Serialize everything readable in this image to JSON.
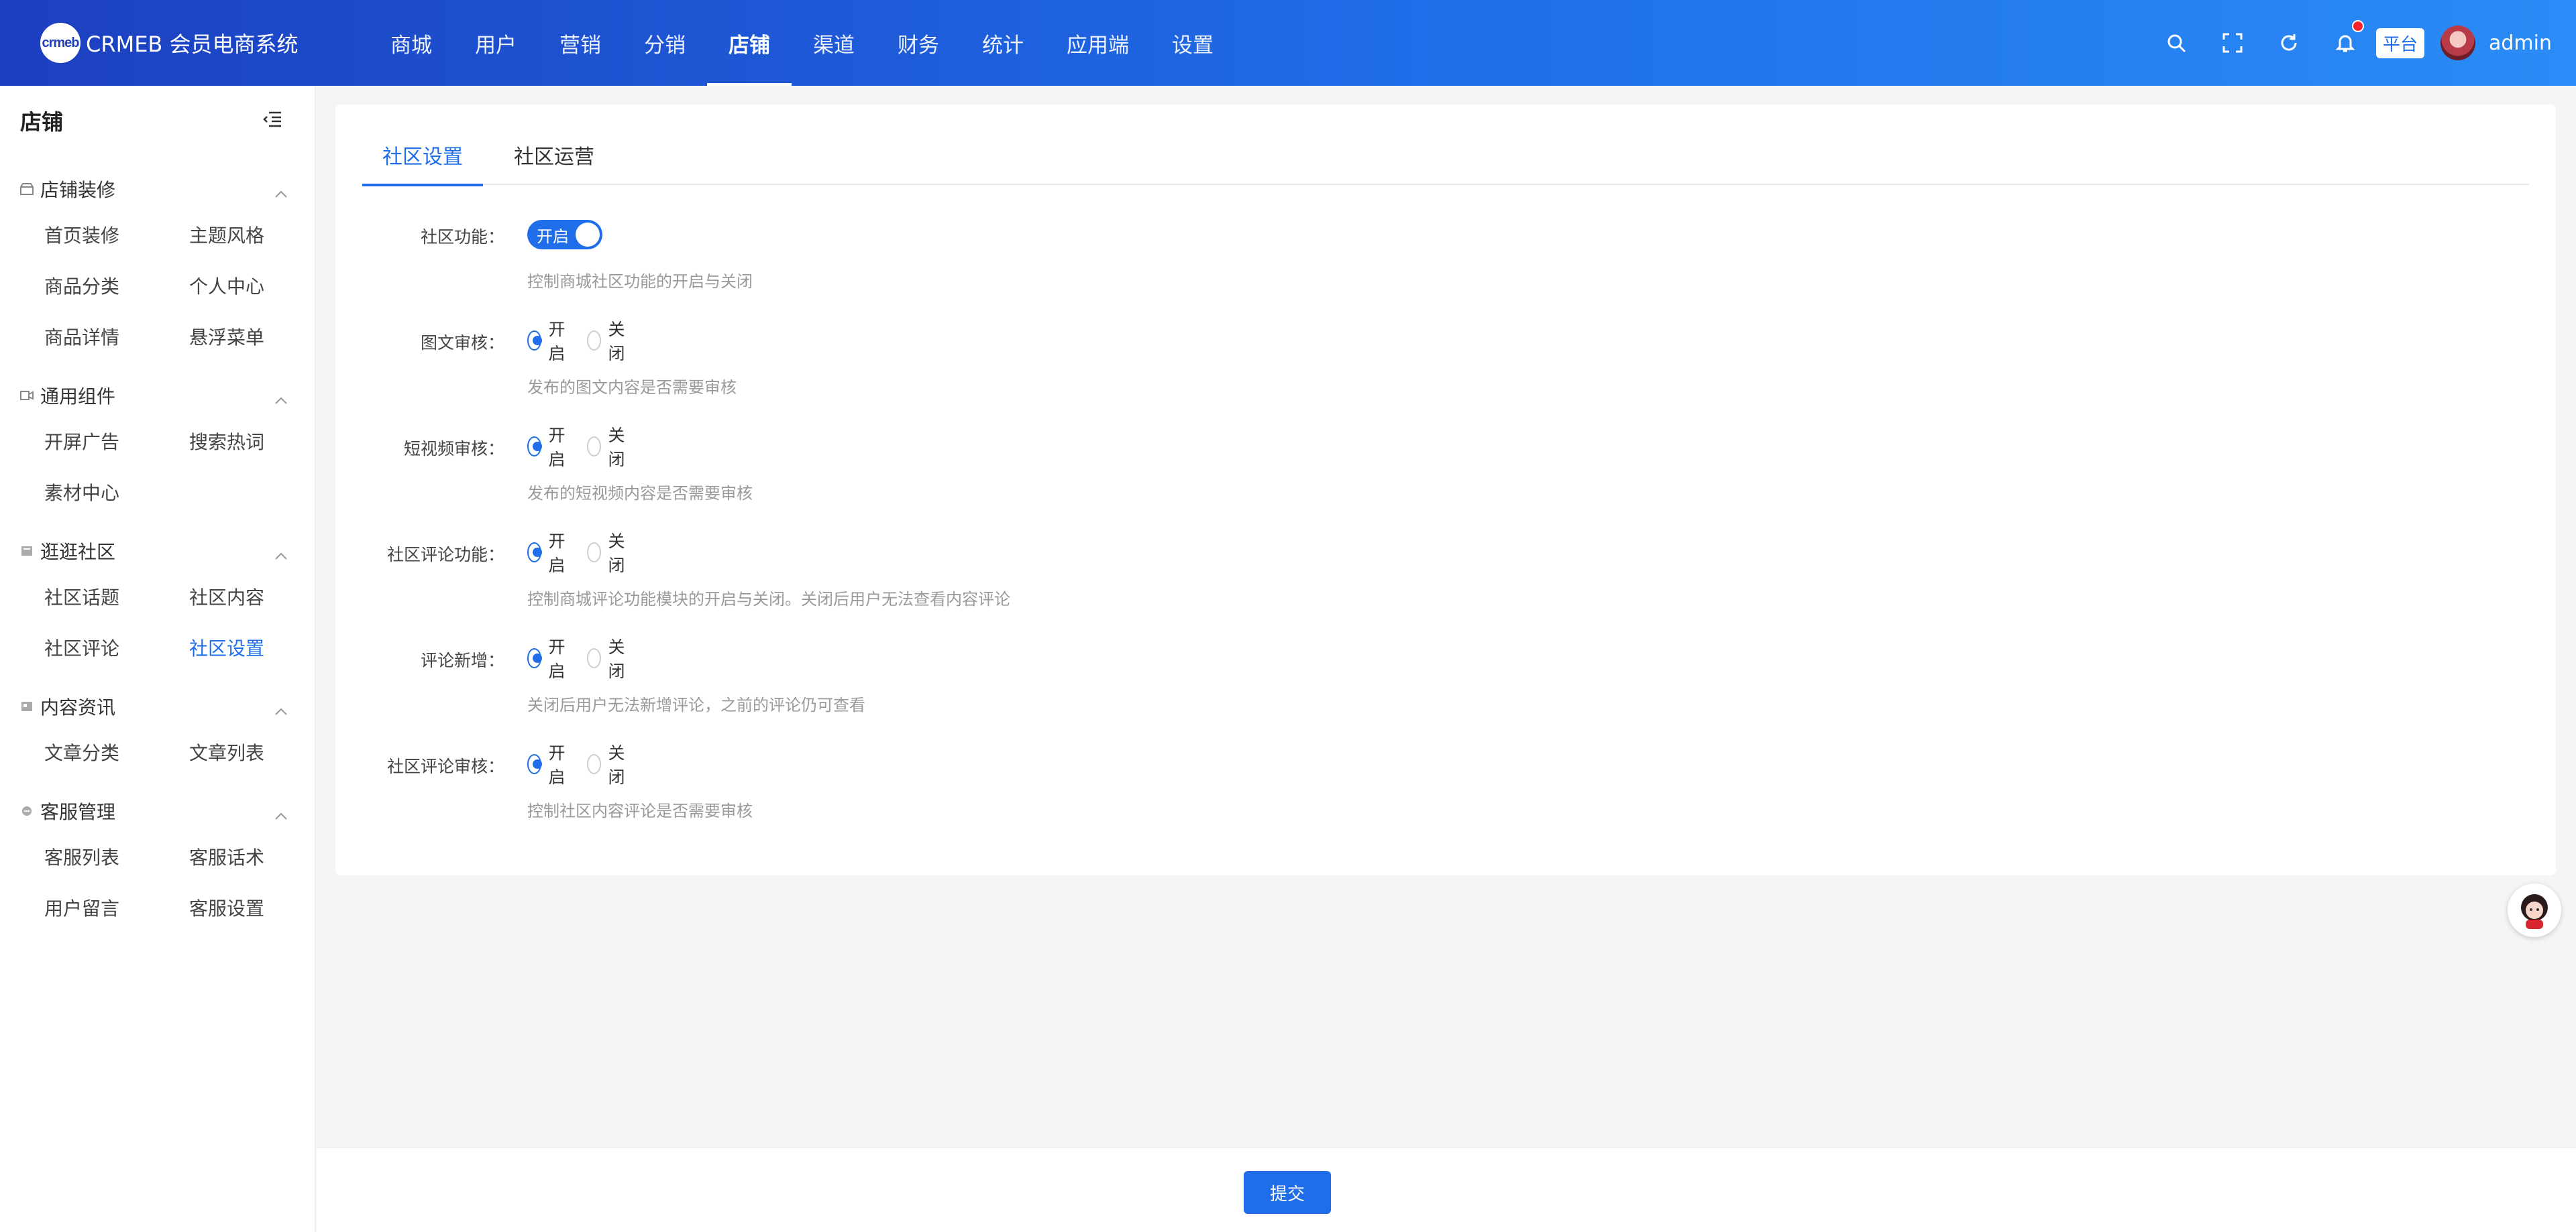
{
  "header": {
    "logo_mark": "crmeb",
    "logo_text": "CRMEB 会员电商系统",
    "nav": [
      "商城",
      "用户",
      "营销",
      "分销",
      "店铺",
      "渠道",
      "财务",
      "统计",
      "应用端",
      "设置"
    ],
    "active_nav": "店铺",
    "platform_label": "平台",
    "user_name": "admin",
    "icons": [
      "search-icon",
      "fullscreen-icon",
      "refresh-icon",
      "bell-icon"
    ]
  },
  "sidebar": {
    "title": "店铺",
    "groups": [
      {
        "label": "店铺装修",
        "icon": "shop-icon",
        "items": [
          "首页装修",
          "主题风格",
          "商品分类",
          "个人中心",
          "商品详情",
          "悬浮菜单"
        ]
      },
      {
        "label": "通用组件",
        "icon": "component-icon",
        "items": [
          "开屏广告",
          "搜索热词",
          "素材中心"
        ]
      },
      {
        "label": "逛逛社区",
        "icon": "community-icon",
        "items": [
          "社区话题",
          "社区内容",
          "社区评论",
          "社区设置"
        ]
      },
      {
        "label": "内容资讯",
        "icon": "news-icon",
        "items": [
          "文章分类",
          "文章列表"
        ]
      },
      {
        "label": "客服管理",
        "icon": "chat-icon",
        "items": [
          "客服列表",
          "客服话术",
          "用户留言",
          "客服设置"
        ]
      }
    ],
    "active_item": "社区设置"
  },
  "tabs": [
    "社区设置",
    "社区运营"
  ],
  "form": {
    "community": {
      "label": "社区功能：",
      "switch_text": "开启",
      "help": "控制商城社区功能的开启与关闭"
    },
    "image_review": {
      "label": "图文审核：",
      "on": "开启",
      "off": "关闭",
      "help": "发布的图文内容是否需要审核"
    },
    "video_review": {
      "label": "短视频审核：",
      "on": "开启",
      "off": "关闭",
      "help": "发布的短视频内容是否需要审核"
    },
    "comment_func": {
      "label": "社区评论功能：",
      "on": "开启",
      "off": "关闭",
      "help": "控制商城评论功能模块的开启与关闭。关闭后用户无法查看内容评论"
    },
    "comment_new": {
      "label": "评论新增：",
      "on": "开启",
      "off": "关闭",
      "help": "关闭后用户无法新增评论，之前的评论仍可查看"
    },
    "comment_review": {
      "label": "社区评论审核：",
      "on": "开启",
      "off": "关闭",
      "help": "控制社区内容评论是否需要审核"
    }
  },
  "footer": {
    "submit": "提交"
  },
  "colors": {
    "primary": "#1f6de8",
    "header_start": "#1c3fc0",
    "header_end": "#2a8cf6"
  }
}
